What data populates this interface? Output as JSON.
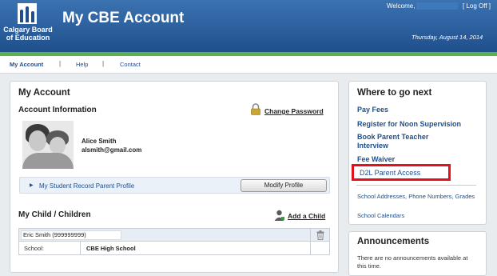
{
  "header": {
    "logo_text": "Calgary Board of Education",
    "app_title": "My CBE Account",
    "welcome": "Welcome,",
    "logoff": "[ Log Off ]",
    "date": "Thursday, August 14, 2014"
  },
  "nav": {
    "items": [
      {
        "label": "My Account"
      },
      {
        "label": "Help"
      },
      {
        "label": "Contact"
      }
    ],
    "separator": "|"
  },
  "account": {
    "title": "My Account",
    "info_title": "Account Information",
    "change_password": "Change Password",
    "name": "Alice Smith",
    "email": "alsmith@gmail.com",
    "profile_link": "My Student Record Parent Profile",
    "modify_button": "Modify Profile",
    "children_title": "My Child / Children",
    "add_child": "Add a Child",
    "child": {
      "name": "Eric Smith (999999999)",
      "school_label": "School:",
      "school_value": "CBE High School"
    }
  },
  "where": {
    "title": "Where to go next",
    "links": [
      {
        "label": "Pay Fees"
      },
      {
        "label": "Register for Noon Supervision"
      },
      {
        "label": "Book Parent Teacher Interview"
      },
      {
        "label": "Fee Waiver"
      }
    ],
    "highlighted": "D2L Parent Access",
    "small_links": [
      {
        "label": "School Addresses, Phone Numbers, Grades"
      },
      {
        "label": "School Calendars"
      }
    ]
  },
  "announcements": {
    "title": "Announcements",
    "text": "There are no announcements available at this time."
  },
  "colors": {
    "header_blue": "#2a5f9e",
    "accent_green": "#5bb24a",
    "link_blue": "#1f4f8d",
    "highlight_red": "#e3111b"
  }
}
